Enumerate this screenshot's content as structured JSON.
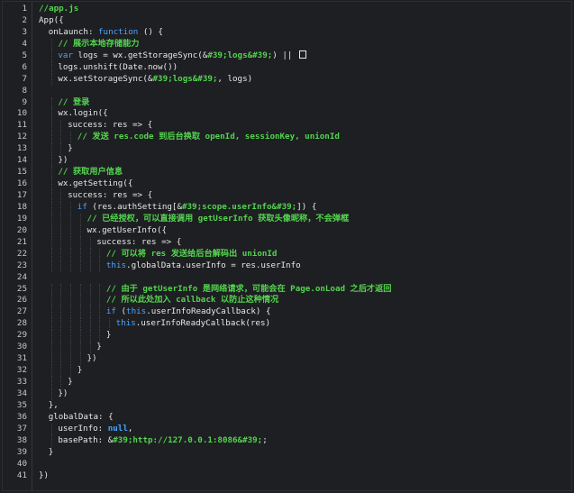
{
  "editor": {
    "lines": [
      {
        "n": "1",
        "indent": 0,
        "tokens": [
          {
            "t": "//app.js",
            "c": "cm"
          }
        ]
      },
      {
        "n": "2",
        "indent": 0,
        "tokens": [
          {
            "t": "App({",
            "c": "id"
          }
        ]
      },
      {
        "n": "3",
        "indent": 1,
        "tokens": [
          {
            "t": "onLaunch: ",
            "c": "id"
          },
          {
            "t": "function",
            "c": "kw"
          },
          {
            "t": " () {",
            "c": "id"
          }
        ]
      },
      {
        "n": "4",
        "indent": 2,
        "tokens": [
          {
            "t": "// 展示本地存储能力",
            "c": "cm"
          }
        ]
      },
      {
        "n": "5",
        "indent": 2,
        "tokens": [
          {
            "t": "var",
            "c": "kw"
          },
          {
            "t": " logs = wx.getStorageSync(&",
            "c": "id"
          },
          {
            "t": "#39;logs&#39;",
            "c": "str"
          },
          {
            "t": ") || ",
            "c": "id"
          },
          {
            "t": "[]",
            "c": "box"
          }
        ]
      },
      {
        "n": "6",
        "indent": 2,
        "tokens": [
          {
            "t": "logs.unshift(Date.now())",
            "c": "id"
          }
        ]
      },
      {
        "n": "7",
        "indent": 2,
        "tokens": [
          {
            "t": "wx.setStorageSync(&",
            "c": "id"
          },
          {
            "t": "#39;logs&#39;",
            "c": "str"
          },
          {
            "t": ", logs)",
            "c": "id"
          }
        ]
      },
      {
        "n": "8",
        "indent": 0,
        "tokens": []
      },
      {
        "n": "9",
        "indent": 2,
        "tokens": [
          {
            "t": "// 登录",
            "c": "cm"
          }
        ]
      },
      {
        "n": "10",
        "indent": 2,
        "tokens": [
          {
            "t": "wx.login({",
            "c": "id"
          }
        ]
      },
      {
        "n": "11",
        "indent": 3,
        "tokens": [
          {
            "t": "success: res => {",
            "c": "id"
          }
        ]
      },
      {
        "n": "12",
        "indent": 4,
        "tokens": [
          {
            "t": "// 发送 res.code 到后台换取 openId, sessionKey, unionId",
            "c": "cm"
          }
        ]
      },
      {
        "n": "13",
        "indent": 3,
        "tokens": [
          {
            "t": "}",
            "c": "id"
          }
        ]
      },
      {
        "n": "14",
        "indent": 2,
        "tokens": [
          {
            "t": "})",
            "c": "id"
          }
        ]
      },
      {
        "n": "15",
        "indent": 2,
        "tokens": [
          {
            "t": "// 获取用户信息",
            "c": "cm"
          }
        ]
      },
      {
        "n": "16",
        "indent": 2,
        "tokens": [
          {
            "t": "wx.getSetting({",
            "c": "id"
          }
        ]
      },
      {
        "n": "17",
        "indent": 3,
        "tokens": [
          {
            "t": "success: res => {",
            "c": "id"
          }
        ]
      },
      {
        "n": "18",
        "indent": 4,
        "tokens": [
          {
            "t": "if",
            "c": "kw"
          },
          {
            "t": " (res.authSetting[&",
            "c": "id"
          },
          {
            "t": "#39;scope.userInfo&#39;",
            "c": "str"
          },
          {
            "t": "]) {",
            "c": "id"
          }
        ]
      },
      {
        "n": "19",
        "indent": 5,
        "tokens": [
          {
            "t": "// 已经授权，可以直接调用 getUserInfo 获取头像昵称，不会弹框",
            "c": "cm"
          }
        ]
      },
      {
        "n": "20",
        "indent": 5,
        "tokens": [
          {
            "t": "wx.getUserInfo({",
            "c": "id"
          }
        ]
      },
      {
        "n": "21",
        "indent": 6,
        "tokens": [
          {
            "t": "success: res => {",
            "c": "id"
          }
        ]
      },
      {
        "n": "22",
        "indent": 7,
        "tokens": [
          {
            "t": "// 可以将 res 发送给后台解码出 unionId",
            "c": "cm"
          }
        ]
      },
      {
        "n": "23",
        "indent": 7,
        "tokens": [
          {
            "t": "this",
            "c": "kw"
          },
          {
            "t": ".globalData.userInfo = res.userInfo",
            "c": "id"
          }
        ]
      },
      {
        "n": "24",
        "indent": 0,
        "tokens": []
      },
      {
        "n": "25",
        "indent": 7,
        "tokens": [
          {
            "t": "// 由于 getUserInfo 是网络请求，可能会在 Page.onLoad 之后才返回",
            "c": "cm"
          }
        ]
      },
      {
        "n": "26",
        "indent": 7,
        "tokens": [
          {
            "t": "// 所以此处加入 callback 以防止这种情况",
            "c": "cm"
          }
        ]
      },
      {
        "n": "27",
        "indent": 7,
        "tokens": [
          {
            "t": "if",
            "c": "kw"
          },
          {
            "t": " (",
            "c": "id"
          },
          {
            "t": "this",
            "c": "kw"
          },
          {
            "t": ".userInfoReadyCallback) {",
            "c": "id"
          }
        ]
      },
      {
        "n": "28",
        "indent": 8,
        "tokens": [
          {
            "t": "this",
            "c": "kw"
          },
          {
            "t": ".userInfoReadyCallback(res)",
            "c": "id"
          }
        ]
      },
      {
        "n": "29",
        "indent": 7,
        "tokens": [
          {
            "t": "}",
            "c": "id"
          }
        ]
      },
      {
        "n": "30",
        "indent": 6,
        "tokens": [
          {
            "t": "}",
            "c": "id"
          }
        ]
      },
      {
        "n": "31",
        "indent": 5,
        "tokens": [
          {
            "t": "})",
            "c": "id"
          }
        ]
      },
      {
        "n": "32",
        "indent": 4,
        "tokens": [
          {
            "t": "}",
            "c": "id"
          }
        ]
      },
      {
        "n": "33",
        "indent": 3,
        "tokens": [
          {
            "t": "}",
            "c": "id"
          }
        ]
      },
      {
        "n": "34",
        "indent": 2,
        "tokens": [
          {
            "t": "})",
            "c": "id"
          }
        ]
      },
      {
        "n": "35",
        "indent": 1,
        "tokens": [
          {
            "t": "},",
            "c": "id"
          }
        ]
      },
      {
        "n": "36",
        "indent": 1,
        "tokens": [
          {
            "t": "globalData: {",
            "c": "id"
          }
        ]
      },
      {
        "n": "37",
        "indent": 2,
        "tokens": [
          {
            "t": "userInfo: ",
            "c": "id"
          },
          {
            "t": "null",
            "c": "lit"
          },
          {
            "t": ",",
            "c": "id"
          }
        ]
      },
      {
        "n": "38",
        "indent": 2,
        "tokens": [
          {
            "t": "basePath: &",
            "c": "id"
          },
          {
            "t": "#39;http://127.0.0.1:8086&#39;",
            "c": "str"
          },
          {
            "t": ";",
            "c": "id"
          }
        ]
      },
      {
        "n": "39",
        "indent": 1,
        "tokens": [
          {
            "t": "}",
            "c": "id"
          }
        ]
      },
      {
        "n": "40",
        "indent": 0,
        "tokens": []
      },
      {
        "n": "41",
        "indent": 0,
        "tokens": [
          {
            "t": "})",
            "c": "id"
          }
        ]
      }
    ]
  },
  "colors": {
    "background": "#1e1f22",
    "keyword": "#4aa3ff",
    "comment": "#53d34f",
    "text": "#e8e8e8",
    "line_number": "#c8c8c8"
  }
}
